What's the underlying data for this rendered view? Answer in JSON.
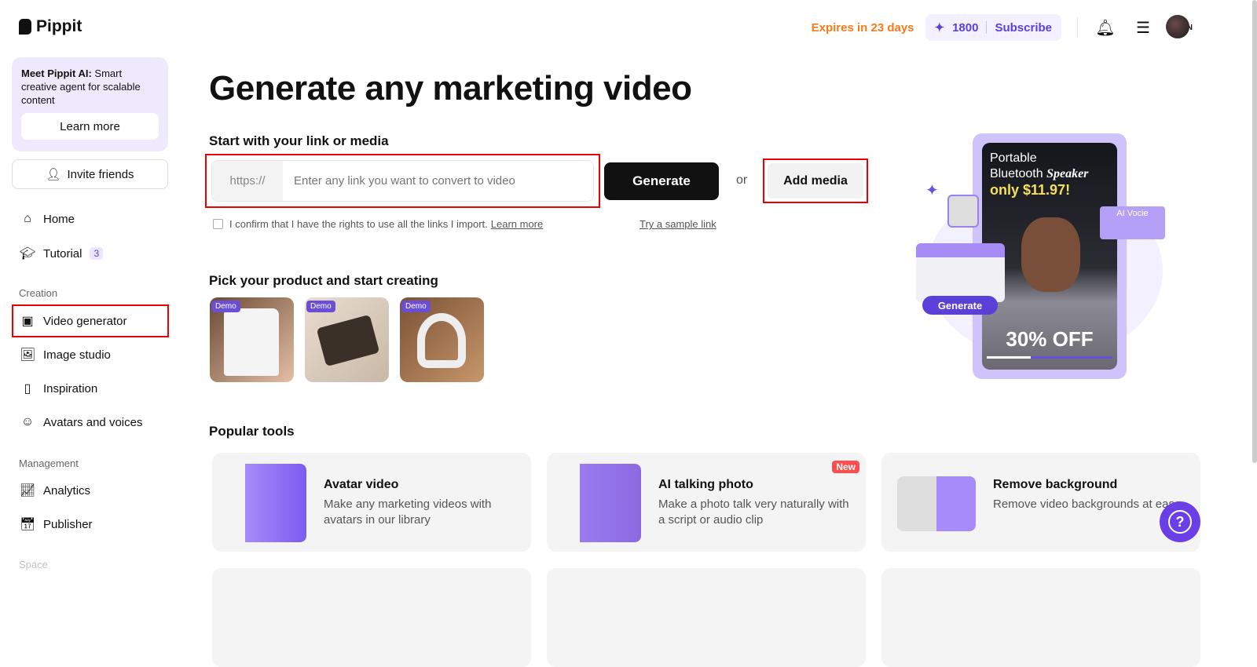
{
  "brand": {
    "name": "Pippit"
  },
  "header": {
    "expires": "Expires in 23 days",
    "credits": "1800",
    "subscribe": "Subscribe",
    "lang": "EN"
  },
  "sidebar": {
    "promo_title": "Meet Pippit AI:",
    "promo_text": " Smart creative agent for scalable content",
    "learn_more": "Learn more",
    "invite": "Invite friends",
    "items": [
      {
        "label": "Home"
      },
      {
        "label": "Tutorial",
        "badge": "3"
      }
    ],
    "creation_label": "Creation",
    "creation": [
      {
        "label": "Video generator"
      },
      {
        "label": "Image studio"
      },
      {
        "label": "Inspiration"
      },
      {
        "label": "Avatars and voices"
      }
    ],
    "management_label": "Management",
    "management": [
      {
        "label": "Analytics"
      },
      {
        "label": "Publisher"
      }
    ],
    "space_label": "Space"
  },
  "main": {
    "title": "Generate any marketing video",
    "link_heading": "Start with your link or media",
    "prefix": "https://",
    "placeholder": "Enter any link you want to convert to video",
    "generate": "Generate",
    "or": "or",
    "add_media": "Add media",
    "confirm": "I confirm that I have the rights to use all the links I import.",
    "confirm_link": "Learn more",
    "sample": "Try a sample link",
    "pick_heading": "Pick your product and start creating",
    "demo": "Demo",
    "popular": "Popular tools",
    "tools": [
      {
        "title": "Avatar video",
        "desc": "Make any marketing videos with avatars in our library"
      },
      {
        "title": "AI talking photo",
        "desc": "Make a photo talk very naturally with a script or audio clip",
        "badge": "New"
      },
      {
        "title": "Remove background",
        "desc": "Remove video backgrounds at ease"
      }
    ]
  },
  "hero": {
    "line1": "Portable",
    "line2": "Bluetooth",
    "line2b": "Speaker",
    "price": "only $11.97!",
    "off": "30% OFF",
    "voice": "AI Vocie",
    "generate": "Generate"
  }
}
